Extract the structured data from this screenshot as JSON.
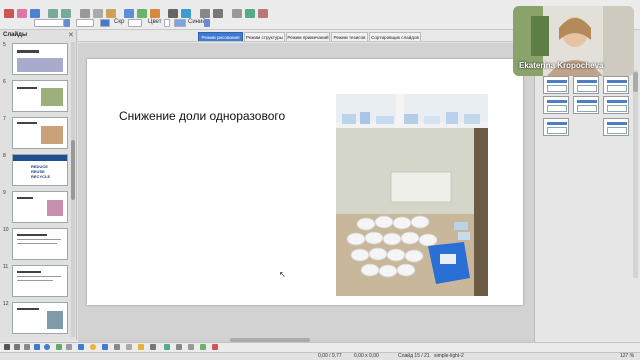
{
  "toolbar": {
    "label_seg": "Скр",
    "label_color": "Цвет",
    "label_blue": "Синий",
    "icons": [
      "new-icon",
      "open-icon",
      "save-icon",
      "undo-icon",
      "redo-icon",
      "cut-icon",
      "copy-icon",
      "paste-icon",
      "table-icon",
      "image-icon",
      "chart-icon",
      "text-icon",
      "shapes-icon",
      "align-icon",
      "arrange-icon",
      "shadow-icon",
      "crop-icon",
      "filter-icon"
    ],
    "accent_color": "#3f7bd1"
  },
  "slides_pane": {
    "title": "Слайды",
    "close_glyph": "✕",
    "numbers": [
      "5",
      "6",
      "7",
      "8",
      "9",
      "10",
      "11",
      "12",
      "13",
      "14",
      "15"
    ],
    "thumb8_lines": [
      "REDUCE",
      "REUSE",
      "RECYCLE"
    ],
    "active_number": "15"
  },
  "view_tabs": [
    "Режим рисования",
    "Режим структуры",
    "Режим примечаний",
    "Режим тезисов",
    "Сортировщик слайдов"
  ],
  "slide": {
    "title": "Снижение доли одноразового"
  },
  "webcam": {
    "name": "Ekaterina Kropocheva"
  },
  "status": {
    "position": "0,00 / 9,77",
    "size": "0,00 x 0,00",
    "slide": "Слайд 15 / 21",
    "layout": "simple-light-2",
    "zoom": "127 %"
  }
}
